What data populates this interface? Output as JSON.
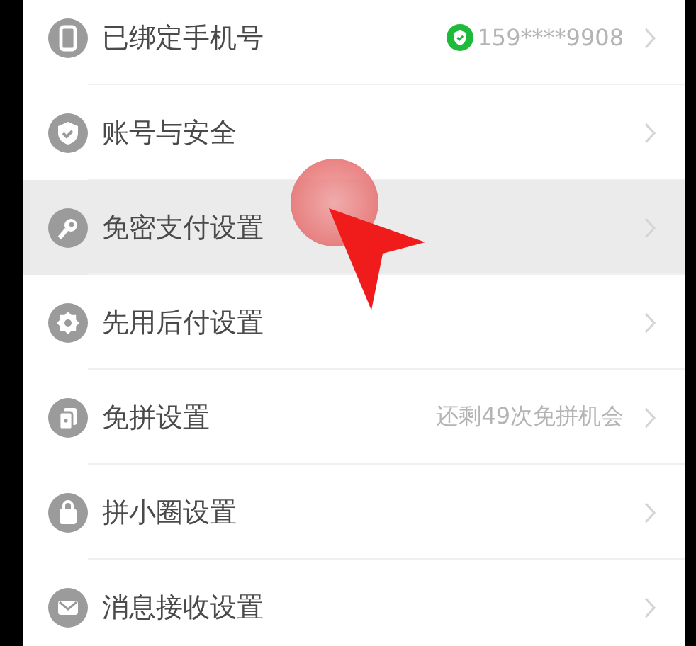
{
  "settings": [
    {
      "label": "已绑定手机号",
      "kind": "phone",
      "value": "159****9908",
      "verified": true,
      "pressed": false
    },
    {
      "label": "账号与安全",
      "kind": "shield",
      "pressed": false
    },
    {
      "label": "免密支付设置",
      "kind": "key",
      "pressed": true
    },
    {
      "label": "先用后付设置",
      "kind": "badge",
      "pressed": false
    },
    {
      "label": "免拼设置",
      "kind": "cards",
      "value": "还剩49次免拼机会",
      "pressed": false
    },
    {
      "label": "拼小圈设置",
      "kind": "bag",
      "pressed": false
    },
    {
      "label": "消息接收设置",
      "kind": "mail",
      "pressed": false
    }
  ]
}
